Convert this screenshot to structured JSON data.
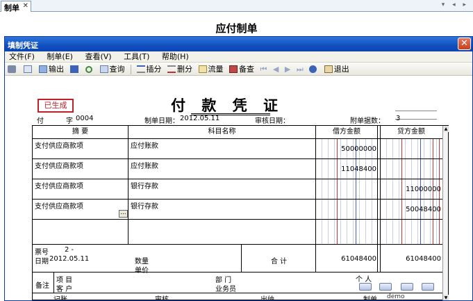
{
  "tab": {
    "label": "制单",
    "close": "✕"
  },
  "tabnav": "▾ ◂ ▸",
  "page": {
    "title": "应付制单"
  },
  "dialog": {
    "title": "填制凭证",
    "menu": [
      "文件(F)",
      "制单(E)",
      "查看(V)",
      "工具(T)",
      "帮助(H)"
    ],
    "toolbar": {
      "output": "输出",
      "query": "查询",
      "insert": "插分",
      "delete": "删分",
      "flow": "流量",
      "memo": "备查",
      "exit": "退出"
    }
  },
  "voucher": {
    "status_stamp": "已生成",
    "title": "付 款 凭 证",
    "type_label": "付",
    "word_label": "字",
    "number": "0004",
    "make_date_label": "制单日期：",
    "make_date": "2012.05.11",
    "audit_date_label": "审核日期：",
    "attach_label": "附单据数：",
    "attach_count": "3",
    "columns": {
      "summary": "摘 要",
      "subject": "科目名称",
      "debit": "借方金额",
      "credit": "贷方金额"
    },
    "rows": [
      {
        "summary": "支付供应商款项",
        "subject": "应付账款",
        "debit": "50000000",
        "credit": ""
      },
      {
        "summary": "支付供应商款项",
        "subject": "应付账款",
        "debit": "11048400",
        "credit": ""
      },
      {
        "summary": "支付供应商款项",
        "subject": "银行存款",
        "debit": "",
        "credit": "11000000"
      },
      {
        "summary": "支付供应商款项",
        "subject": "银行存款",
        "debit": "",
        "credit": "50048400"
      }
    ],
    "row_ellipsis": "...",
    "footer": {
      "ticket_label": "票号",
      "ticket_value": "2 -",
      "date_label": "日期",
      "date_value": "2012.05.11",
      "qty_label": "数量",
      "price_label": "单价",
      "total_label": "合 计",
      "total_debit": "61048400",
      "total_credit": "61048400"
    },
    "memo": {
      "label": "备注",
      "project_label": "项 目",
      "customer_label": "客 户",
      "dept_label": "部 门",
      "staff_label": "业务员",
      "person_label": "个 人"
    },
    "signatures": {
      "bookkeep_label": "记账",
      "audit_label": "审核",
      "cashier_label": "出纳",
      "maker_label": "制单",
      "maker_value": "demo"
    }
  }
}
